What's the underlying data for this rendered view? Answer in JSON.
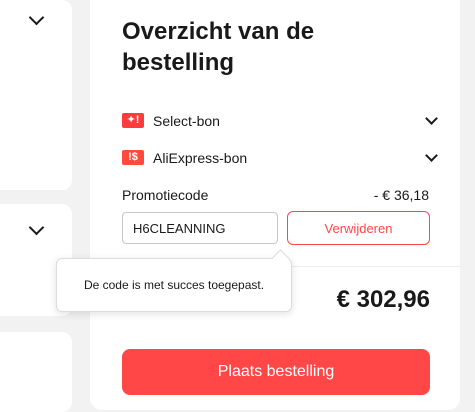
{
  "summary": {
    "title": "Overzicht van de bestelling",
    "coupons": [
      {
        "label": "Select-bon",
        "icon": "select-coupon-icon",
        "icon_glyph": "✦!",
        "color": "#ff3b3b"
      },
      {
        "label": "AliExpress-bon",
        "icon": "aliexpress-coupon-icon",
        "icon_glyph": "!$",
        "color": "#ff4a3d"
      }
    ],
    "promo": {
      "label": "Promotiecode",
      "discount": "- € 36,18",
      "code_value": "H6CLEANNING",
      "remove_label": "Verwijderen"
    },
    "tooltip": "De code is met succes toegepast.",
    "total": "€ 302,96",
    "place_order_label": "Plaats bestelling"
  },
  "colors": {
    "accent": "#ff4747",
    "background": "#f2f2f2",
    "card": "#ffffff"
  }
}
